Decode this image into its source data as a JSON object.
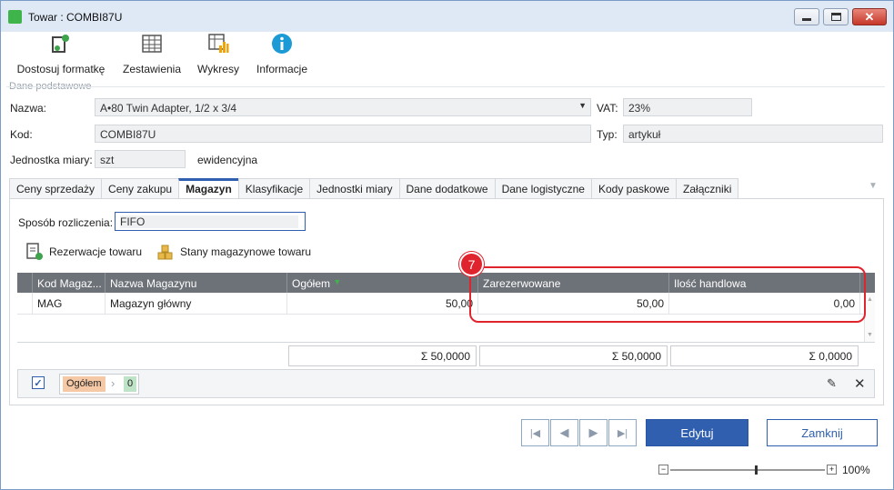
{
  "window": {
    "title": "Towar : COMBI87U"
  },
  "toolbar": {
    "customize": "Dostosuj formatkę",
    "reports": "Zestawienia",
    "charts": "Wykresy",
    "info": "Informacje"
  },
  "basic": {
    "section_label": "Dane podstawowe",
    "name_label": "Nazwa:",
    "name_value": "A•80 Twin Adapter, 1/2 x 3/4",
    "vat_label": "VAT:",
    "vat_value": "23%",
    "code_label": "Kod:",
    "code_value": "COMBI87U",
    "type_label": "Typ:",
    "type_value": "artykuł",
    "unit_label": "Jednostka miary:",
    "unit_value": "szt",
    "unit_note": "ewidencyjna"
  },
  "tabs": [
    {
      "label": "Ceny sprzedaży"
    },
    {
      "label": "Ceny zakupu"
    },
    {
      "label": "Magazyn"
    },
    {
      "label": "Klasyfikacje"
    },
    {
      "label": "Jednostki miary"
    },
    {
      "label": "Dane dodatkowe"
    },
    {
      "label": "Dane logistyczne"
    },
    {
      "label": "Kody paskowe"
    },
    {
      "label": "Załączniki"
    }
  ],
  "warehouse": {
    "method_label": "Sposób rozliczenia:",
    "method_value": "FIFO",
    "reservations_btn": "Rezerwacje towaru",
    "stock_btn": "Stany magazynowe towaru",
    "columns": [
      "Kod Magaz...",
      "Nazwa Magazynu",
      "Ogółem",
      "Zarezerwowane",
      "Ilość handlowa"
    ],
    "rows": [
      {
        "code": "MAG",
        "name": "Magazyn główny",
        "total": "50,00",
        "reserved": "50,00",
        "available": "0,00"
      }
    ],
    "sums": {
      "total": "Σ 50,0000",
      "reserved": "Σ 50,0000",
      "available": "Σ 0,0000"
    },
    "filter_chip": "Ogółem",
    "filter_value": "0"
  },
  "annotation": {
    "badge": "7"
  },
  "buttons": {
    "edit": "Edytuj",
    "close": "Zamknij"
  },
  "zoom": {
    "level": "100%",
    "fraction": 0.55
  },
  "colors": {
    "accent": "#2f5fae",
    "primary_button": "#2f5fae",
    "grid_header": "#6d7178",
    "annotation": "#e0242e"
  }
}
